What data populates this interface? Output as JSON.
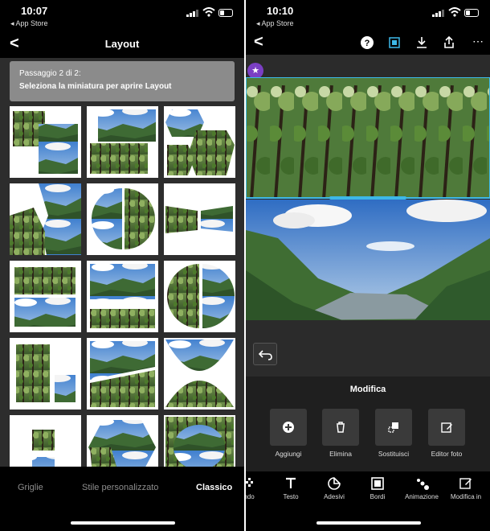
{
  "left": {
    "status": {
      "time": "10:07",
      "back_app": "◂ App Store"
    },
    "header": {
      "back_icon": "chevron-left-icon",
      "title": "Layout"
    },
    "step": {
      "line1": "Passaggio 2 di 2:",
      "line2": "Seleziona la miniatura per aprire Layout"
    },
    "tabs": [
      {
        "label": "Griglie",
        "active": false
      },
      {
        "label": "Stile personalizzato",
        "active": false
      },
      {
        "label": "Classico",
        "active": true
      }
    ]
  },
  "right": {
    "status": {
      "time": "10:10",
      "back_app": "◂ App Store"
    },
    "header_icons": [
      "chevron-left-icon",
      "help-icon",
      "crop-icon",
      "download-icon",
      "share-icon"
    ],
    "panel": {
      "title": "Modifica",
      "buttons": [
        {
          "label": "Aggiungi",
          "icon": "add-icon"
        },
        {
          "label": "Elimina",
          "icon": "trash-icon"
        },
        {
          "label": "Sostituisci",
          "icon": "replace-icon"
        },
        {
          "label": "Editor foto",
          "icon": "edit-icon"
        }
      ]
    },
    "toolbar": [
      {
        "label": "ndo",
        "icon": "background-icon"
      },
      {
        "label": "Testo",
        "icon": "text-icon"
      },
      {
        "label": "Adesivi",
        "icon": "sticker-icon"
      },
      {
        "label": "Bordi",
        "icon": "border-icon"
      },
      {
        "label": "Animazione",
        "icon": "animation-icon"
      },
      {
        "label": "Modifica in",
        "icon": "edit-in-icon"
      }
    ]
  },
  "colors": {
    "forest": "#4f7a3a",
    "sky": "#6f9fd6",
    "accent": "#3db8e8",
    "premium": "#7b3fc4"
  }
}
